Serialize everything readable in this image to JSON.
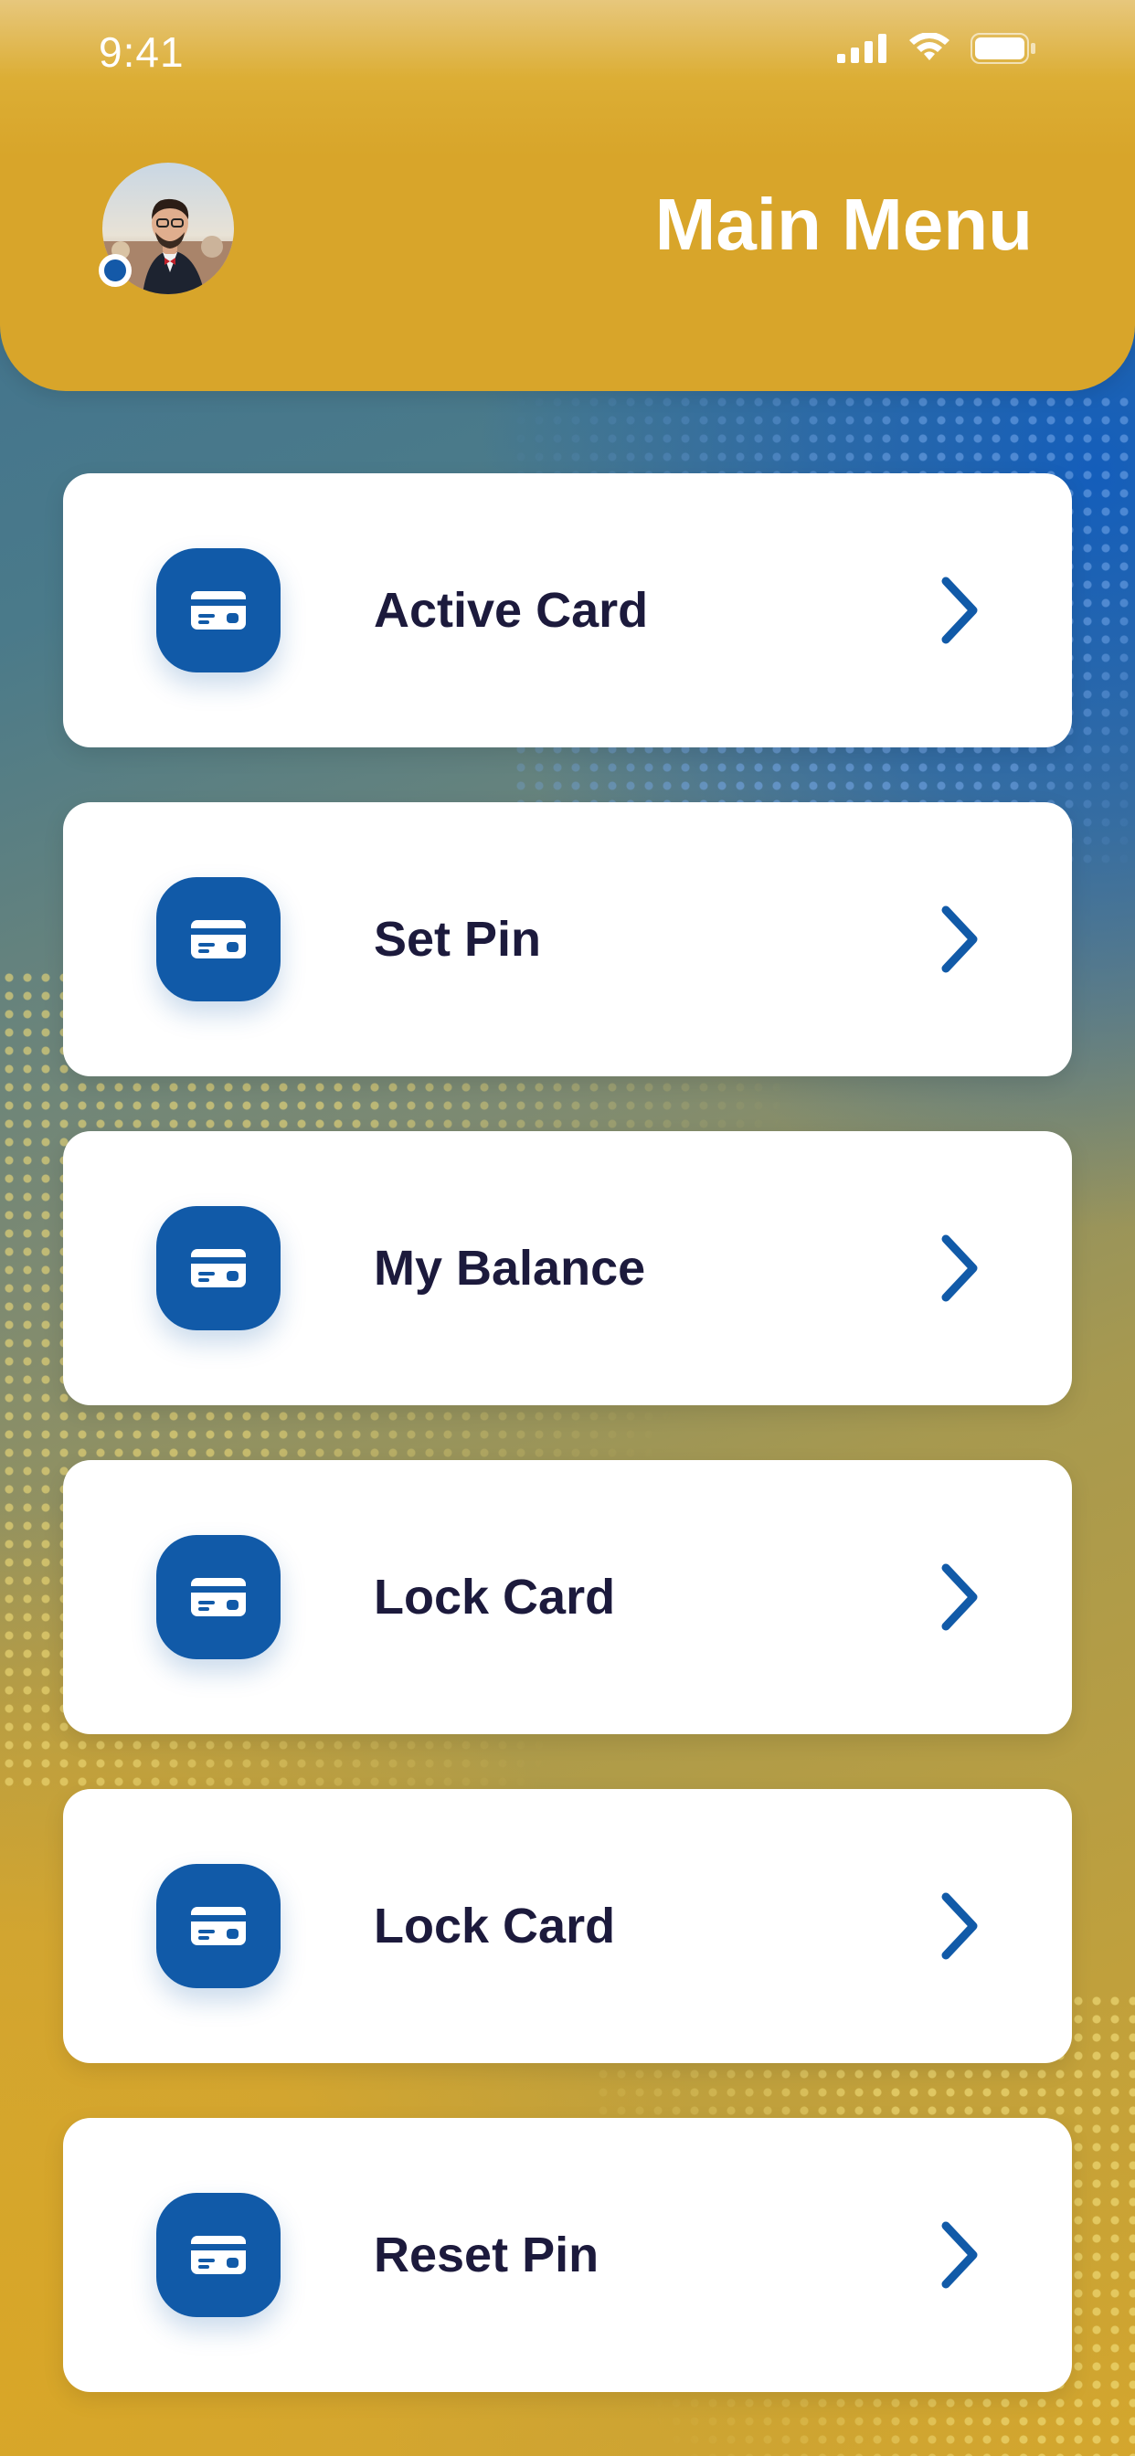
{
  "status_bar": {
    "time": "9:41",
    "icons": [
      "cellular-signal-icon",
      "wifi-icon",
      "battery-icon"
    ]
  },
  "header": {
    "title": "Main Menu",
    "avatar": {
      "status": "online"
    }
  },
  "colors": {
    "header_gold": "#d8a52a",
    "accent_blue": "#115aa8",
    "label_text": "#1c1a3c",
    "card_bg": "#ffffff"
  },
  "menu": {
    "items": [
      {
        "label": "Active Card",
        "icon": "credit-card-icon"
      },
      {
        "label": "Set Pin",
        "icon": "credit-card-icon"
      },
      {
        "label": "My Balance",
        "icon": "credit-card-icon"
      },
      {
        "label": "Lock Card",
        "icon": "credit-card-icon"
      },
      {
        "label": "Lock Card",
        "icon": "credit-card-icon"
      },
      {
        "label": "Reset Pin",
        "icon": "credit-card-icon"
      }
    ]
  }
}
